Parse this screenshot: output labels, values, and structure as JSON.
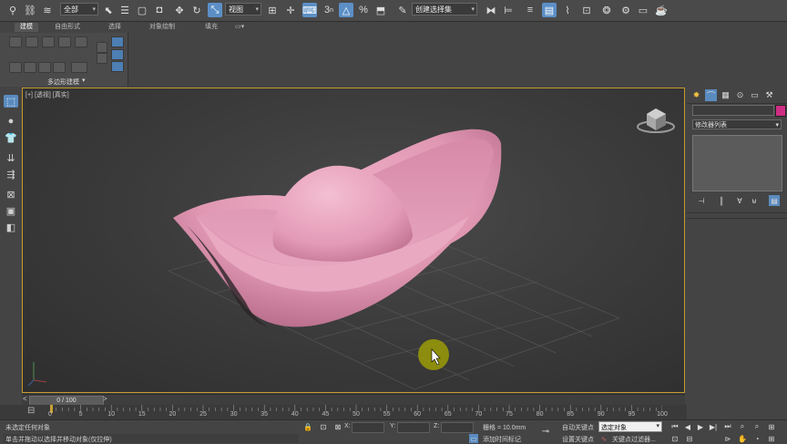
{
  "main_toolbar": {
    "selection_filter": "全部",
    "reference_coord": "视图",
    "named_selection_set": "创建选择集",
    "angle_snap_label": "3"
  },
  "ribbon": {
    "tabs": [
      "建模",
      "自由形式",
      "选择",
      "对象绘制",
      "填充"
    ],
    "panel_label": "多边形建模"
  },
  "viewport": {
    "label_plus": "[+]",
    "label_view": "[透视]",
    "label_shading": "[真实]",
    "object_color": "#e29ab5"
  },
  "command_panel": {
    "modifier_list": "修改器列表",
    "color_swatch": "#d02e84"
  },
  "timeline": {
    "frame_display": "0 / 100"
  },
  "trackbar": {
    "ticks": [
      "0",
      "5",
      "10",
      "15",
      "20",
      "25",
      "30",
      "35",
      "40",
      "45",
      "50",
      "55",
      "60",
      "65",
      "70",
      "75",
      "80",
      "85",
      "90",
      "95",
      "100"
    ]
  },
  "status": {
    "selection_status": "未选定任何对象",
    "prompt": "单击并拖动以选择并移动对象(仅拉伸)",
    "x_label": "X:",
    "y_label": "Y:",
    "z_label": "Z:",
    "grid": "栅格 = 10.0mm",
    "add_time_tag": "添加时间标记",
    "auto_key": "自动关键点",
    "set_key": "设置关键点",
    "selected_object": "选定对象",
    "key_filters": "关键点过滤器..."
  }
}
